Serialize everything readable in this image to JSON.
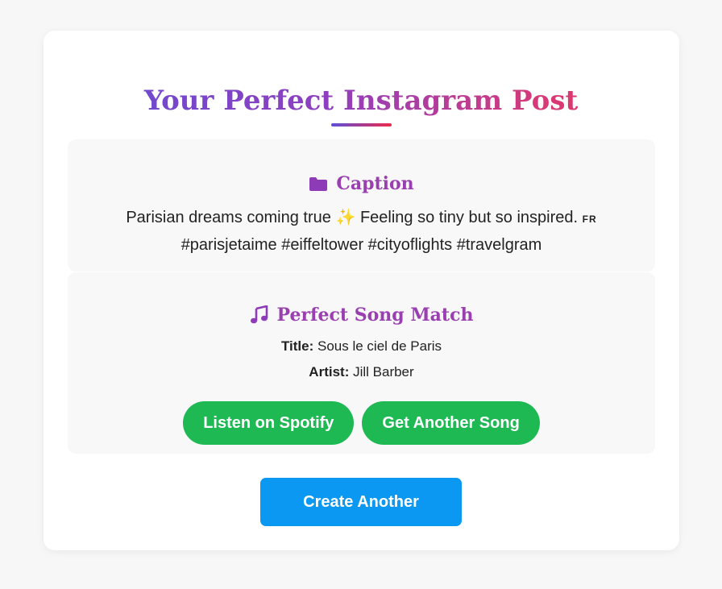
{
  "header": {
    "title": "Your Perfect Instagram Post"
  },
  "caption": {
    "heading": "Caption",
    "icon": "folder-icon",
    "text_main": "Parisian dreams coming true",
    "sparkle": "✨",
    "text_feeling": "Feeling so tiny but so inspired.",
    "flag": "FR",
    "hashtags": "#parisjetaime #eiffeltower #cityoflights #travelgram"
  },
  "song": {
    "heading": "Perfect Song Match",
    "icon": "music-note-icon",
    "title_label": "Title:",
    "title_value": "Sous le ciel de Paris",
    "artist_label": "Artist:",
    "artist_value": "Jill Barber",
    "spotify_button": "Listen on Spotify",
    "another_song_button": "Get Another Song"
  },
  "actions": {
    "create_another": "Create Another"
  },
  "colors": {
    "accent_purple": "#9a3fb0",
    "spotify_green": "#1fb954",
    "primary_blue": "#0a98f2"
  }
}
